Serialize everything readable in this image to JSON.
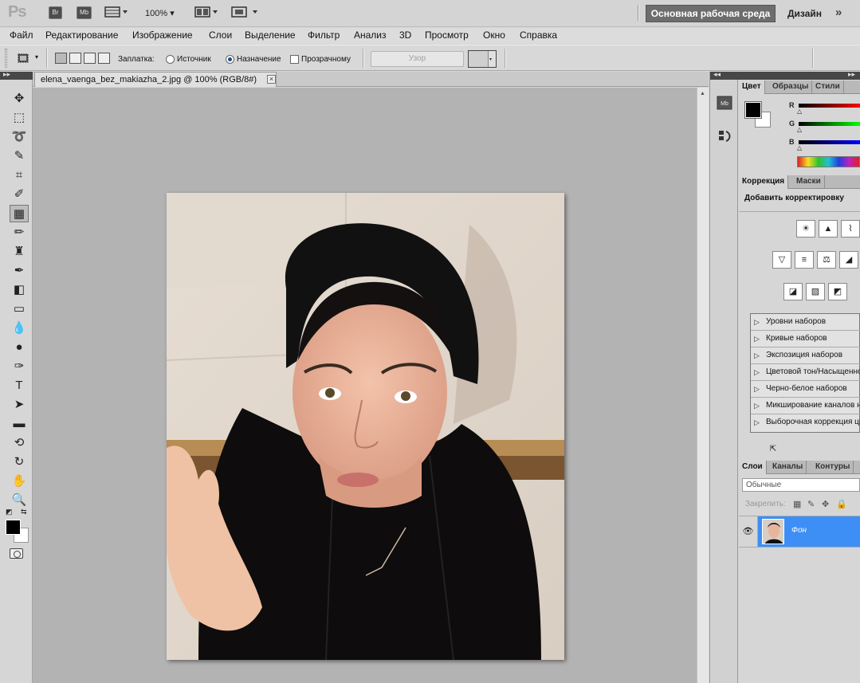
{
  "app": {
    "logo": "Ps",
    "bridge": "Br",
    "mini_bridge": "Mb",
    "zoom": "100%",
    "workspace_active": "Основная рабочая среда",
    "workspace_design": "Дизайн",
    "more": "»"
  },
  "menu": [
    "Файл",
    "Редактирование",
    "Изображение",
    "Слои",
    "Выделение",
    "Фильтр",
    "Анализ",
    "3D",
    "Просмотр",
    "Окно",
    "Справка"
  ],
  "options": {
    "patch_label": "Заплатка:",
    "source_label": "Источник",
    "dest_label": "Назначение",
    "transparent_label": "Прозрачному",
    "pattern_button": "Узор",
    "selected_mode": "dest"
  },
  "document": {
    "tab_title": "elena_vaenga_bez_makiazha_2.jpg @ 100% (RGB/8#)",
    "close": "×"
  },
  "color_panel": {
    "tabs": [
      "Цвет",
      "Образцы",
      "Стили"
    ],
    "channels": [
      "R",
      "G",
      "B"
    ],
    "foreground": "#000000",
    "background": "#ffffff"
  },
  "adjustments": {
    "tabs": [
      "Коррекция",
      "Маски"
    ],
    "title": "Добавить корректировку",
    "presets": [
      "Уровни наборов",
      "Кривые наборов",
      "Экспозиция наборов",
      "Цветовой тон/Насыщенность наборов",
      "Черно-белое наборов",
      "Микширование каналов наборов",
      "Выборочная коррекция цвета наборов"
    ]
  },
  "layers": {
    "tabs": [
      "Слои",
      "Каналы",
      "Контуры"
    ],
    "blend_mode": "Обычные",
    "lock_label": "Закрепить:",
    "items": [
      {
        "name": "Фон",
        "visible": true,
        "selected": true
      }
    ]
  },
  "colors": {
    "accent": "#3d8ff6",
    "workspace_btn": "#6d6d6d",
    "canvas_bg": "#b3b3b3"
  }
}
